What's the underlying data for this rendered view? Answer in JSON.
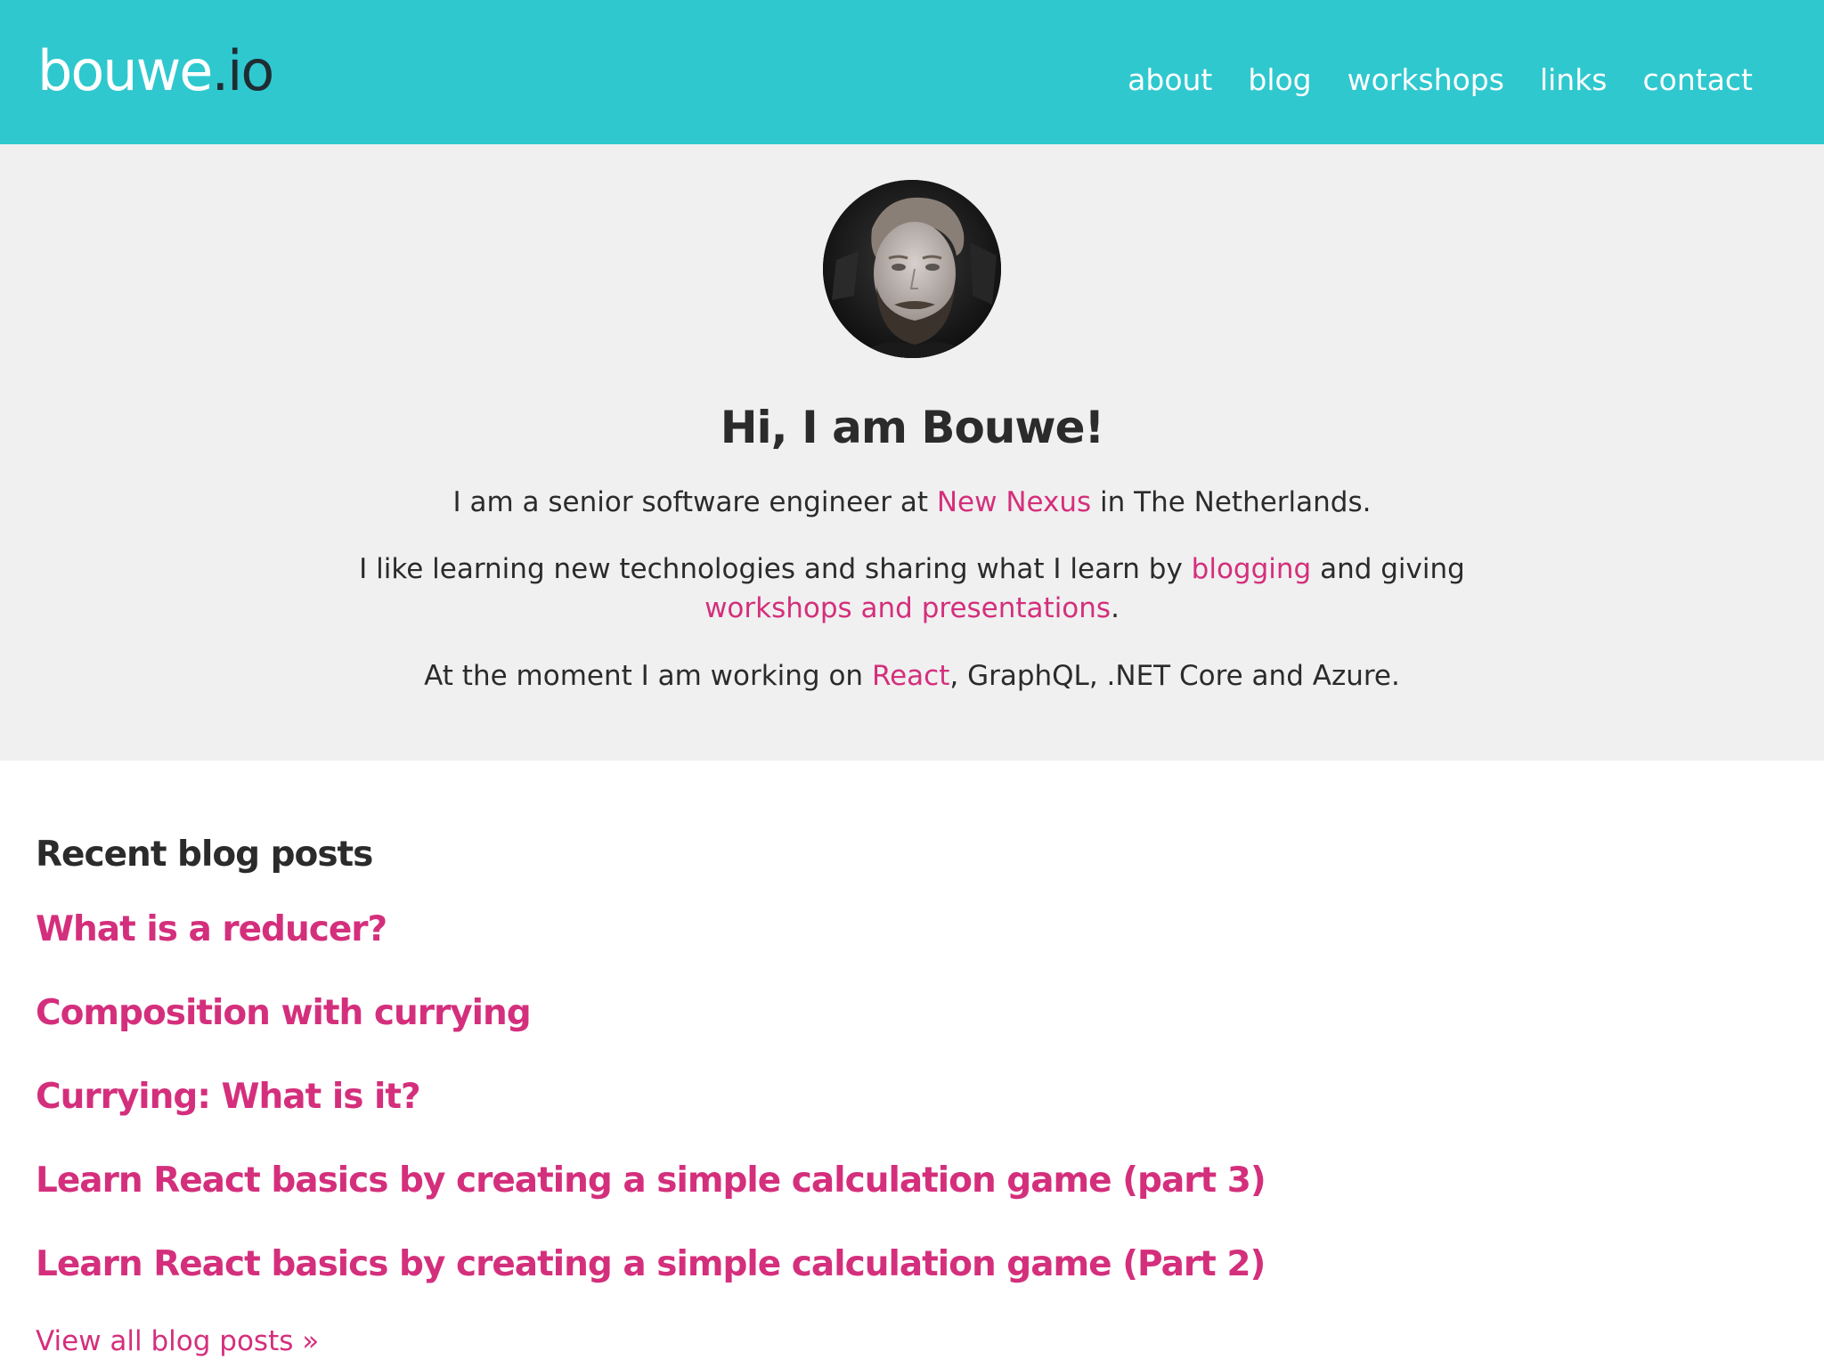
{
  "header": {
    "logo_main": "bouwe",
    "logo_tld": ".io",
    "nav": [
      "about",
      "blog",
      "workshops",
      "links",
      "contact"
    ]
  },
  "intro": {
    "title": "Hi, I am Bouwe!",
    "p1": {
      "before": "I am a senior software engineer at ",
      "link": "New Nexus",
      "after": " in The Netherlands."
    },
    "p2": {
      "before": "I like learning new technologies and sharing what I learn by ",
      "link1": "blogging",
      "middle": " and giving ",
      "link2": "workshops and presentations",
      "after": "."
    },
    "p3": {
      "before": "At the moment I am working on ",
      "link": "React",
      "after": ", GraphQL, .NET Core and Azure."
    }
  },
  "recent": {
    "heading": "Recent blog posts",
    "posts": [
      "What is a reducer?",
      "Composition with currying",
      "Currying: What is it?",
      "Learn React basics by creating a simple calculation game (part 3)",
      "Learn React basics by creating a simple calculation game (Part 2)"
    ],
    "view_all": "View all blog posts »"
  },
  "colors": {
    "header_bg": "#2fc8cf",
    "intro_bg": "#f0f0f0",
    "accent": "#d42f7c",
    "text": "#2b2b2b"
  }
}
